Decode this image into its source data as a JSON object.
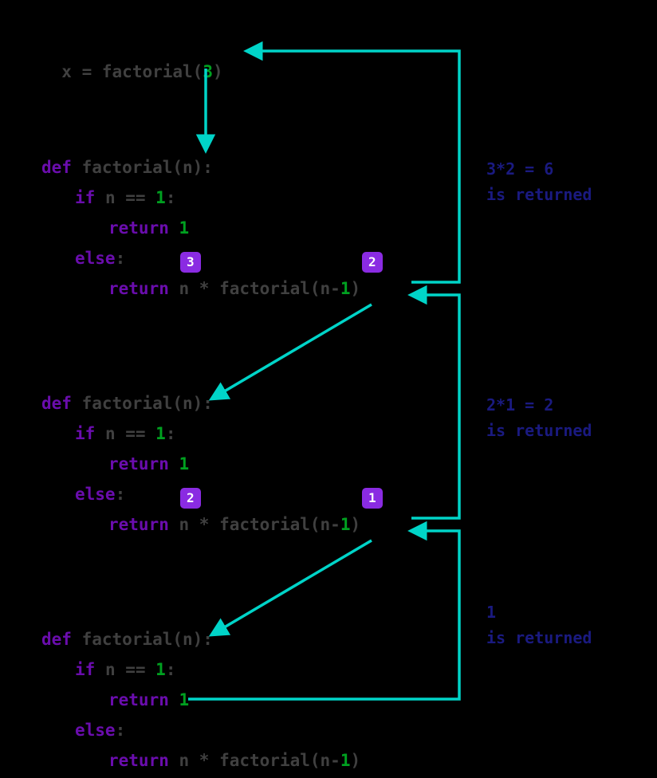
{
  "call": {
    "lhs": "x ",
    "eq": "= ",
    "fn": "factorial(",
    "arg": "3",
    "close": ")"
  },
  "block": {
    "def_kw": "def ",
    "def_name": "factorial(n):",
    "if_kw": "if ",
    "if_cond": "n == ",
    "one": "1",
    "colon": ":",
    "return_kw": "return ",
    "return_one": "1",
    "else_kw": "else",
    "else_colon": ":",
    "ret2_kw": "return ",
    "ret2_expr": "n * factorial(n-",
    "ret2_one": "1",
    "ret2_close": ")"
  },
  "badges": {
    "b1": "3",
    "b2": "2",
    "b3": "2",
    "b4": "1"
  },
  "annots": {
    "a1_top": "3*2 = 6",
    "a1_bot": "is returned",
    "a2_top": "2*1 = 2",
    "a2_bot": "is returned",
    "a3_top": "1",
    "a3_bot": "is returned"
  },
  "colors": {
    "arrow": "#00d4c8",
    "badge": "#8a2be2",
    "annot": "#1a1a80",
    "kw": "#6a0dad",
    "num": "#00a020",
    "dim": "#404040"
  }
}
